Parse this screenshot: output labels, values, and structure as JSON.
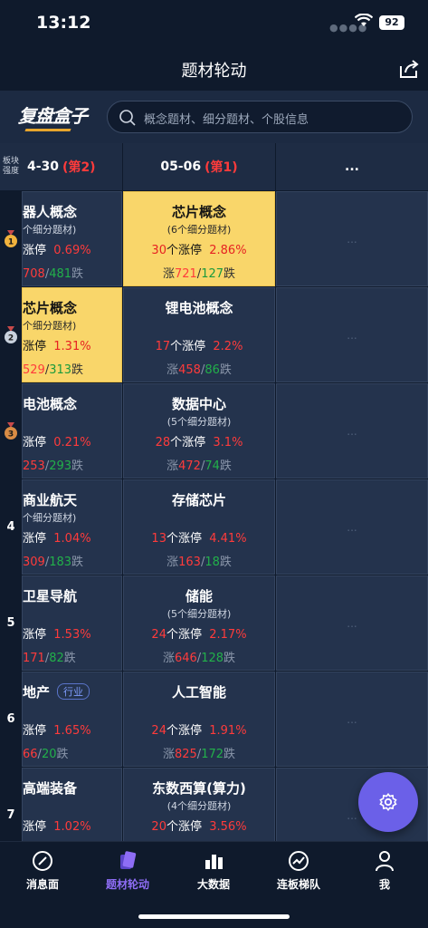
{
  "status": {
    "time": "13:12",
    "battery": "92"
  },
  "nav": {
    "title": "题材轮动"
  },
  "logo": {
    "text": "复盘盒子"
  },
  "search": {
    "placeholder": "概念题材、细分题材、个股信息"
  },
  "table": {
    "side_header": [
      "板块",
      "强度"
    ],
    "columns": [
      {
        "date": "4-30",
        "rank": "(第2)"
      },
      {
        "date": "05-06",
        "rank": "(第1)"
      },
      {
        "date": "..."
      }
    ],
    "ranks": [
      "1",
      "2",
      "3",
      "4",
      "5",
      "6",
      "7"
    ],
    "rank_icons": [
      "gold-medal-icon",
      "silver-medal-icon",
      "bronze-medal-icon"
    ],
    "col1": [
      {
        "name": "器人概念",
        "sub": "个细分题材)",
        "lim_n": "",
        "lim_label": "涨停",
        "pct": "0.69%",
        "up": "708",
        "down": "481",
        "down_label": "跌"
      },
      {
        "name": "芯片概念",
        "sub": "个细分题材)",
        "lim_label": "涨停",
        "pct": "1.31%",
        "up": "529",
        "down": "313",
        "down_label": "跌"
      },
      {
        "name": "电池概念",
        "sub": "",
        "lim_label": "涨停",
        "pct": "0.21%",
        "up": "253",
        "down": "293",
        "down_label": "跌"
      },
      {
        "name": "商业航天",
        "sub": "个细分题材)",
        "lim_label": "涨停",
        "pct": "1.04%",
        "up": "309",
        "down": "183",
        "down_label": "跌"
      },
      {
        "name": "卫星导航",
        "sub": "",
        "lim_label": "涨停",
        "pct": "1.53%",
        "up": "171",
        "down": "82",
        "down_label": "跌"
      },
      {
        "name": "地产",
        "tag": "行业",
        "sub": "",
        "lim_label": "涨停",
        "pct": "1.65%",
        "up": "66",
        "down": "20",
        "down_label": "跌"
      },
      {
        "name": "高端装备",
        "sub": "",
        "lim_label": "涨停",
        "pct": "1.02%",
        "up": "",
        "down": "",
        "down_label": ""
      }
    ],
    "col2": [
      {
        "name": "芯片概念",
        "sub": "(6个细分题材)",
        "lim_n": "30",
        "lim_label": "个涨停",
        "pct": "2.86%",
        "up_label": "涨",
        "up": "721",
        "down": "127",
        "down_label": "跌"
      },
      {
        "name": "锂电池概念",
        "sub": "",
        "lim_n": "17",
        "lim_label": "个涨停",
        "pct": "2.2%",
        "up_label": "涨",
        "up": "458",
        "down": "86",
        "down_label": "跌"
      },
      {
        "name": "数据中心",
        "sub": "(5个细分题材)",
        "lim_n": "28",
        "lim_label": "个涨停",
        "pct": "3.1%",
        "up_label": "涨",
        "up": "472",
        "down": "74",
        "down_label": "跌"
      },
      {
        "name": "存储芯片",
        "sub": "",
        "lim_n": "13",
        "lim_label": "个涨停",
        "pct": "4.41%",
        "up_label": "涨",
        "up": "163",
        "down": "18",
        "down_label": "跌"
      },
      {
        "name": "储能",
        "sub": "(5个细分题材)",
        "lim_n": "24",
        "lim_label": "个涨停",
        "pct": "2.17%",
        "up_label": "涨",
        "up": "646",
        "down": "128",
        "down_label": "跌"
      },
      {
        "name": "人工智能",
        "sub": "",
        "lim_n": "24",
        "lim_label": "个涨停",
        "pct": "1.91%",
        "up_label": "涨",
        "up": "825",
        "down": "172",
        "down_label": "跌"
      },
      {
        "name": "东数西算(算力)",
        "sub": "(4个细分题材)",
        "lim_n": "20",
        "lim_label": "个涨停",
        "pct": "3.56%",
        "up_label": "",
        "up": "",
        "down": "",
        "down_label": ""
      }
    ],
    "more": "..."
  },
  "tabs": [
    {
      "label": "消息面",
      "icon": "compass-icon"
    },
    {
      "label": "题材轮动",
      "icon": "cards-icon",
      "active": true
    },
    {
      "label": "大数据",
      "icon": "data-icon"
    },
    {
      "label": "连板梯队",
      "icon": "trend-icon"
    },
    {
      "label": "我",
      "icon": "user-icon"
    }
  ],
  "colors": {
    "up": "#ff3b3b",
    "down": "#22b04a",
    "highlight": "#f9d66a",
    "accent": "#6b60e8",
    "tab_active": "#8e6df5"
  }
}
